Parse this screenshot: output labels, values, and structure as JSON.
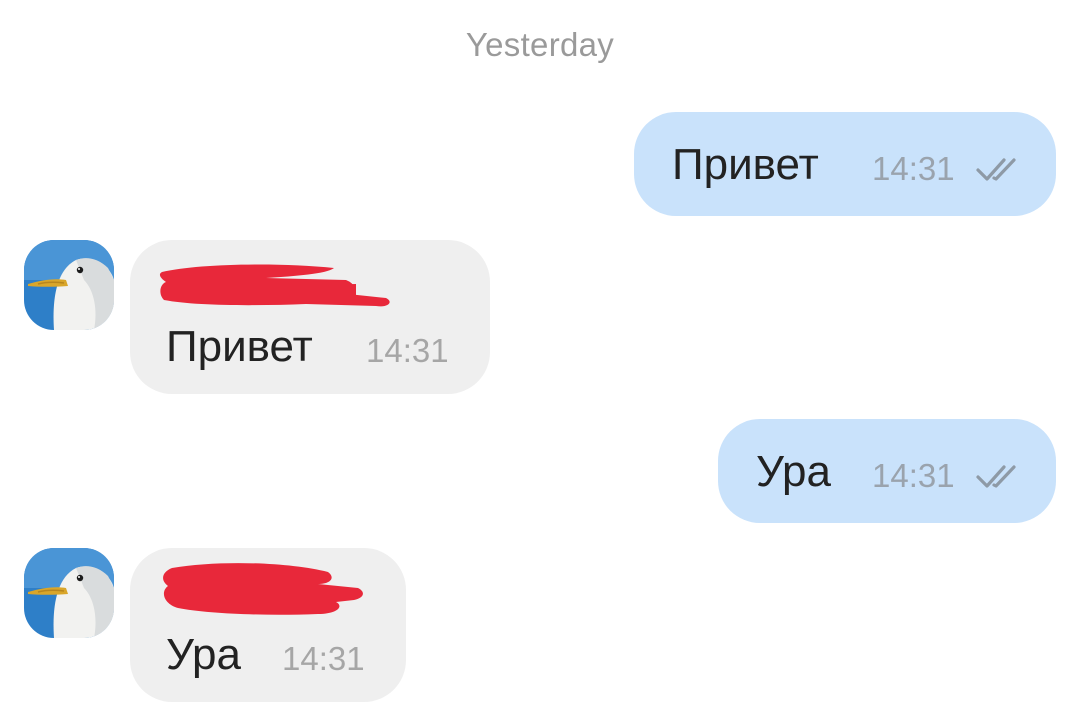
{
  "date_separator": "Yesterday",
  "messages": [
    {
      "direction": "outgoing",
      "text": "Привет",
      "time": "14:31",
      "status_icon": "double-check-icon"
    },
    {
      "direction": "incoming",
      "sender": "",
      "text": "Привет",
      "time": "14:31",
      "avatar_icon": "seagull-avatar"
    },
    {
      "direction": "outgoing",
      "text": "Ура",
      "time": "14:31",
      "status_icon": "double-check-icon"
    },
    {
      "direction": "incoming",
      "sender": "",
      "text": "Ура",
      "time": "14:31",
      "avatar_icon": "seagull-avatar"
    }
  ],
  "colors": {
    "outgoing_bubble": "#c9e2fb",
    "incoming_bubble": "#efefef",
    "redaction": "#e8283a",
    "time_text": "#9aa3ad",
    "check_marks": "#8e9aa6"
  }
}
